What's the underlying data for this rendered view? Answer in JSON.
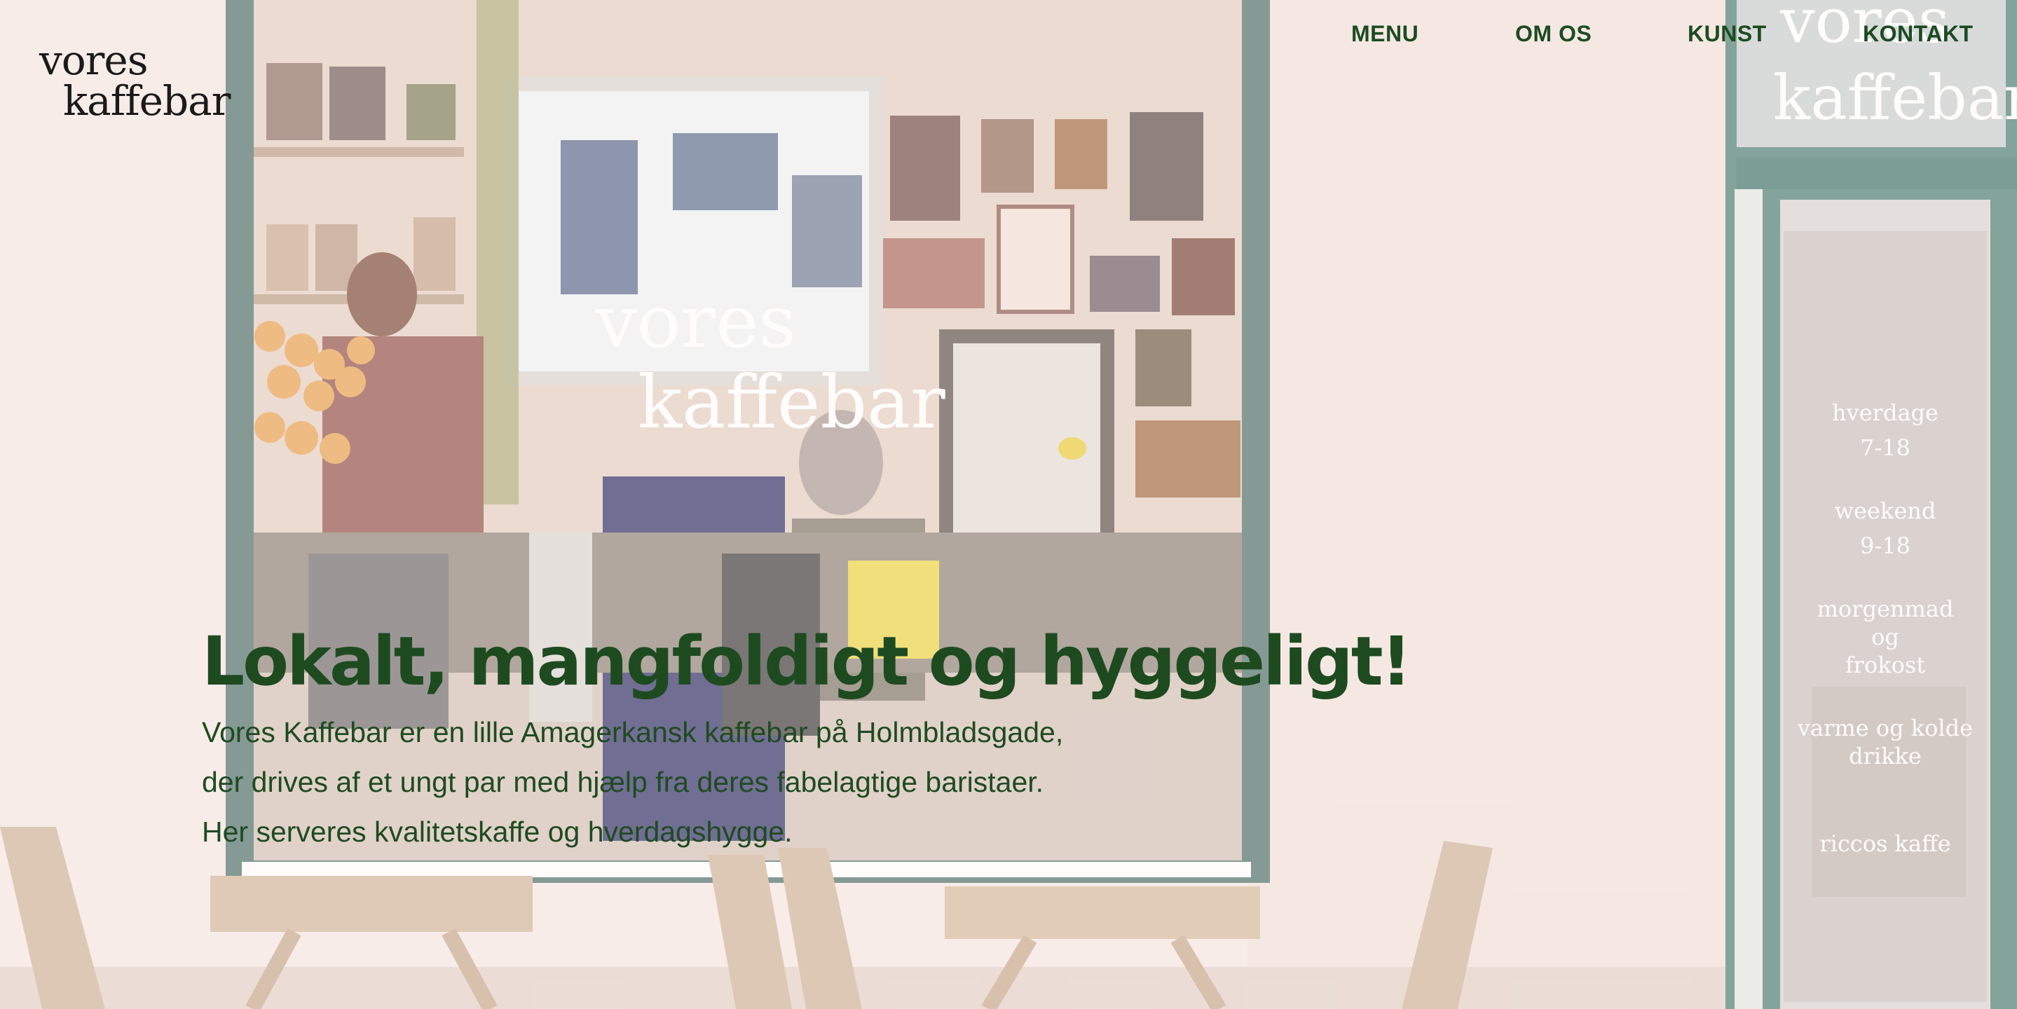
{
  "logo": {
    "line1": "vores",
    "line2": "kaffebar"
  },
  "nav": {
    "items": [
      "MENU",
      "OM OS",
      "KUNST",
      "KONTAKT"
    ]
  },
  "hero": {
    "headline": "Lokalt, mangfoldigt og hyggeligt!",
    "description_lines": [
      "Vores Kaffebar er en lille Amagerkansk kaffebar på Holmbladsgade,",
      "der drives af et ungt par med hjælp fra deres fabelagtige baristaer.",
      "Her serveres kvalitetskaffe og hverdagshygge."
    ],
    "window_text_1": "vores",
    "window_text_2": "kaffebar",
    "sign_text_1": "vores",
    "sign_text_2": "kaffebar",
    "door_text": [
      "hverdage",
      "7-18",
      "weekend",
      "9-18",
      "morgenmad",
      "og",
      "frokost",
      "varme og kolde",
      "drikke",
      "riccos kaffe"
    ]
  },
  "colors": {
    "accent_green": "#1e4a20",
    "frame_teal": "#3f7469",
    "wall": "#f3e6e1"
  }
}
